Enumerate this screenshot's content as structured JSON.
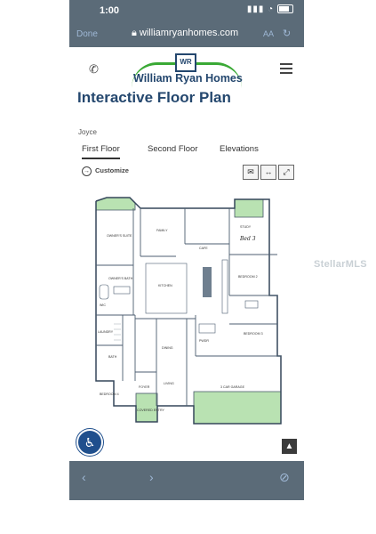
{
  "status_bar": {
    "time": "1:00"
  },
  "browser": {
    "done_label": "Done",
    "url": "williamryanhomes.com",
    "text_size_label": "AA"
  },
  "site": {
    "logo_initials": "WR",
    "brand_name": "William Ryan Homes"
  },
  "page": {
    "title": "Interactive Floor Plan",
    "model_name": "Joyce",
    "tabs": [
      {
        "label": "First Floor"
      },
      {
        "label": "Second Floor"
      },
      {
        "label": "Elevations"
      }
    ],
    "customize_label": "Customize"
  },
  "floor_plan": {
    "rooms": {
      "owners_suite": "OWNER'S SUITE",
      "owners_bath": "OWNER'S BATH",
      "laundry": "LAUNDRY",
      "family": "FAMILY",
      "cafe": "CAFE",
      "kitchen": "KITCHEN",
      "study": "STUDY",
      "bed_3": "Bed 3",
      "bedroom_2": "BEDROOM 2",
      "bedroom_3": "BEDROOM 3",
      "bedroom_4": "BEDROOM 4",
      "dining": "DINING",
      "living": "LIVING",
      "foyer": "FOYER",
      "covered_entry": "COVERED ENTRY",
      "garage": "3 CAR GARAGE",
      "bath": "BATH",
      "wic": "WIC",
      "pwdr": "PWDR"
    }
  },
  "watermark": "StellarMLS",
  "icons": {
    "phone": "phone-icon",
    "menu": "hamburger-menu-icon",
    "lock": "lock-icon",
    "reload": "reload-icon",
    "customize": "circle-arrow-icon",
    "email": "email-icon",
    "resize": "horizontal-arrows-icon",
    "fullscreen": "fullscreen-icon",
    "accessibility": "accessibility-icon",
    "scroll_top": "chevron-up-icon",
    "back": "chevron-left-icon",
    "forward": "chevron-right-icon",
    "compass": "compass-icon"
  },
  "colors": {
    "brand_blue": "#24476e",
    "brand_green": "#3aa935",
    "browser_chrome": "#5b6b78",
    "plan_green": "#b9e2b2"
  }
}
